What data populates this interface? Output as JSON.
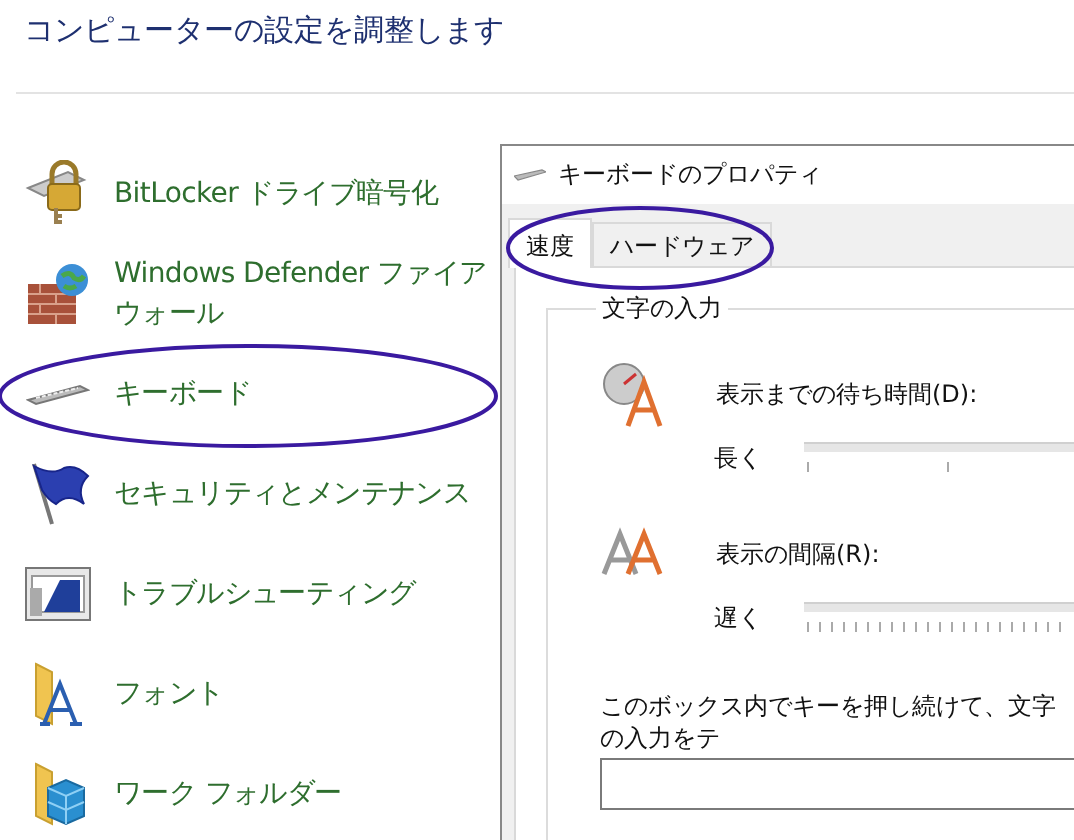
{
  "page_title": "コンピューターの設定を調整します",
  "items": [
    {
      "lines": [
        "BitLocker ドライブ暗号化"
      ],
      "circled": false
    },
    {
      "lines": [
        "Windows Defender ファイア",
        "ウォール"
      ],
      "circled": false
    },
    {
      "lines": [
        "キーボード"
      ],
      "circled": true
    },
    {
      "lines": [
        "セキュリティとメンテナンス"
      ],
      "circled": false
    },
    {
      "lines": [
        "トラブルシューティング"
      ],
      "circled": false
    },
    {
      "lines": [
        "フォント"
      ],
      "circled": false
    },
    {
      "lines": [
        "ワーク フォルダー"
      ],
      "circled": false
    }
  ],
  "dialog": {
    "title": "キーボードのプロパティ",
    "tabs": [
      {
        "label": "速度",
        "selected": true
      },
      {
        "label": "ハードウェア",
        "selected": false
      }
    ],
    "tabs_circled": true,
    "group_title": "文字の入力",
    "settings": [
      {
        "label": "表示までの待ち時間(D):",
        "scale_label": "長く"
      },
      {
        "label": "表示の間隔(R):",
        "scale_label": "遅く"
      }
    ],
    "test_label": "このボックス内でキーを押し続けて、文字の入力をテ"
  }
}
